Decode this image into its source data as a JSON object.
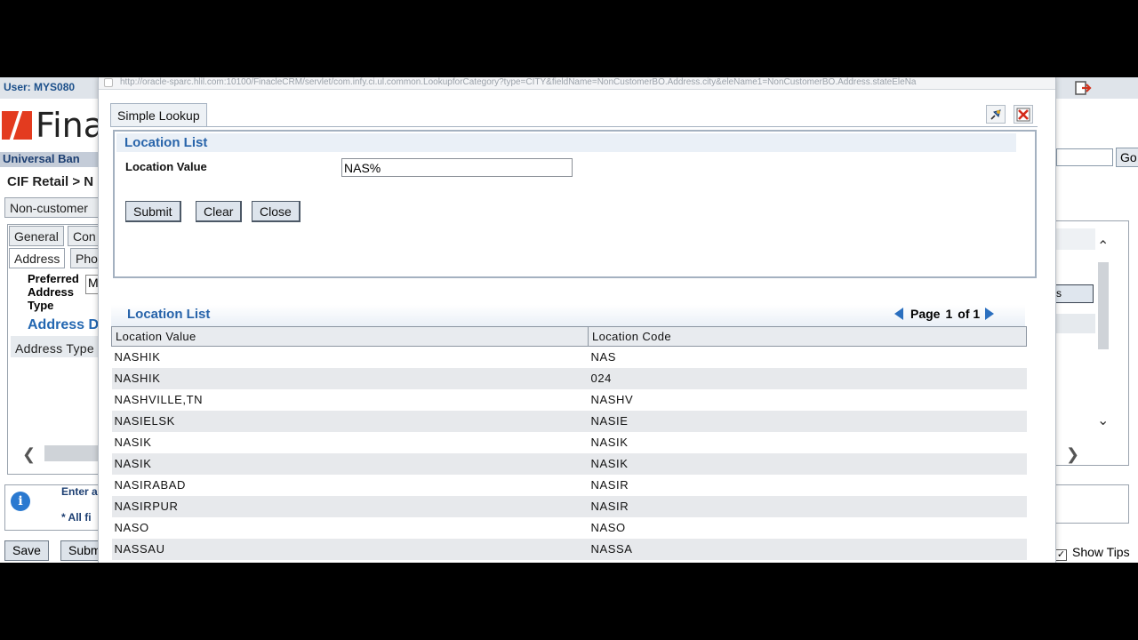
{
  "background": {
    "user_label": "User: MYS080",
    "logo_text": "Fina",
    "subbar_text": "Universal Ban",
    "breadcrumb": "CIF Retail > N",
    "tab_noncustomer": "Non-customer",
    "tab_general": "General",
    "tab_con": "Con",
    "tab_address": "Address",
    "tab_pho": "Pho",
    "preferred_label": "Preferred Address Type",
    "preferred_value": "M",
    "address_details": "Address D",
    "address_type_col": "Address Type",
    "info_enter": "Enter a",
    "info_all_fields": "* All fi",
    "save_label": "Save",
    "submit_label": "Subm",
    "go_label": "Go",
    "right_btn_fragment": "s",
    "show_tips": "Show Tips",
    "check_mark": "✓"
  },
  "popup": {
    "url": "http://oracle-sparc.hlil.com:10100/FinacleCRM/servlet/com.infy.ci.ul.common.LookupforCategory?type=CITY&fieldName=NonCustomerBO.Address.city&eleName1=NonCustomerBO.Address.stateEleNa",
    "tab_label": "Simple Lookup",
    "criteria": {
      "title": "Location List",
      "field_label": "Location Value",
      "field_value": "NAS%",
      "submit_label": "Submit",
      "clear_label": "Clear",
      "close_label": "Close"
    },
    "results": {
      "title": "Location List",
      "page_label": "Page",
      "page_current": "1",
      "page_total": "of 1",
      "columns": [
        "Location Value",
        "Location Code"
      ],
      "rows": [
        [
          "NASHIK",
          "NAS"
        ],
        [
          "NASHIK",
          "024"
        ],
        [
          "NASHVILLE,TN",
          "NASHV"
        ],
        [
          "NASIELSK",
          "NASIE"
        ],
        [
          "NASIK",
          "NASIK"
        ],
        [
          "NASIK",
          "NASIK"
        ],
        [
          "NASIRABAD",
          "NASIR"
        ],
        [
          "NASIRPUR",
          "NASIR"
        ],
        [
          "NASO",
          "NASO"
        ],
        [
          "NASSAU",
          "NASSA"
        ]
      ]
    }
  },
  "colors": {
    "section_title": "#2864aa",
    "alt_row": "#e7e9ec",
    "pager_arrow": "#2a6fbf"
  }
}
